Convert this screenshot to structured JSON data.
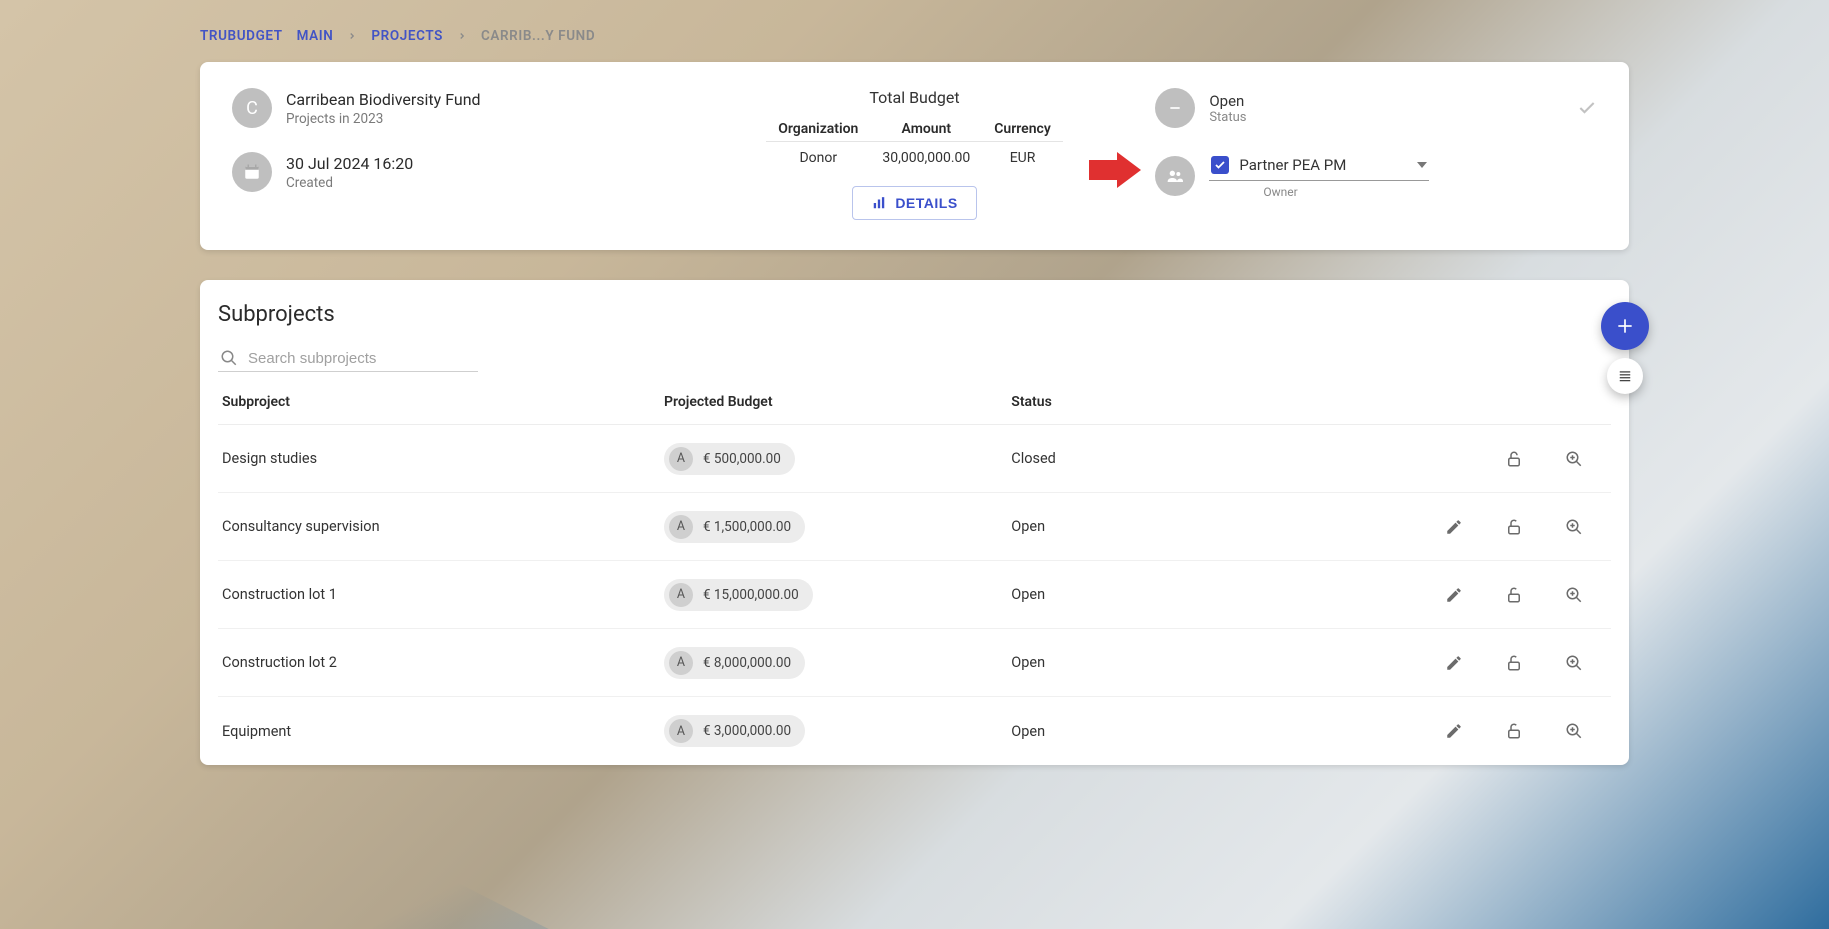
{
  "breadcrumbs": {
    "app": "TRUBUDGET",
    "main": "MAIN",
    "projects": "PROJECTS",
    "current": "CARRIB...Y FUND"
  },
  "project": {
    "initial": "C",
    "title": "Carribean Biodiversity Fund",
    "subtitle": "Projects in 2023",
    "created_at": "30 Jul 2024 16:20",
    "created_label": "Created",
    "budget_title": "Total Budget",
    "cols": {
      "org": "Organization",
      "amount": "Amount",
      "currency": "Currency"
    },
    "row": {
      "org": "Donor",
      "amount": "30,000,000.00",
      "currency": "EUR"
    },
    "details_label": "DETAILS",
    "status": {
      "value": "Open",
      "label": "Status"
    },
    "owner": {
      "value": "Partner PEA PM",
      "label": "Owner"
    }
  },
  "subprojects": {
    "heading": "Subprojects",
    "search_placeholder": "Search subprojects",
    "cols": {
      "name": "Subproject",
      "budget": "Projected Budget",
      "status": "Status"
    },
    "pill_letter": "A",
    "rows": [
      {
        "name": "Design studies",
        "budget": "€ 500,000.00",
        "status": "Closed",
        "editable": false
      },
      {
        "name": "Consultancy supervision",
        "budget": "€ 1,500,000.00",
        "status": "Open",
        "editable": true
      },
      {
        "name": "Construction lot 1",
        "budget": "€ 15,000,000.00",
        "status": "Open",
        "editable": true
      },
      {
        "name": "Construction lot 2",
        "budget": "€ 8,000,000.00",
        "status": "Open",
        "editable": true
      },
      {
        "name": "Equipment",
        "budget": "€ 3,000,000.00",
        "status": "Open",
        "editable": true
      }
    ]
  }
}
